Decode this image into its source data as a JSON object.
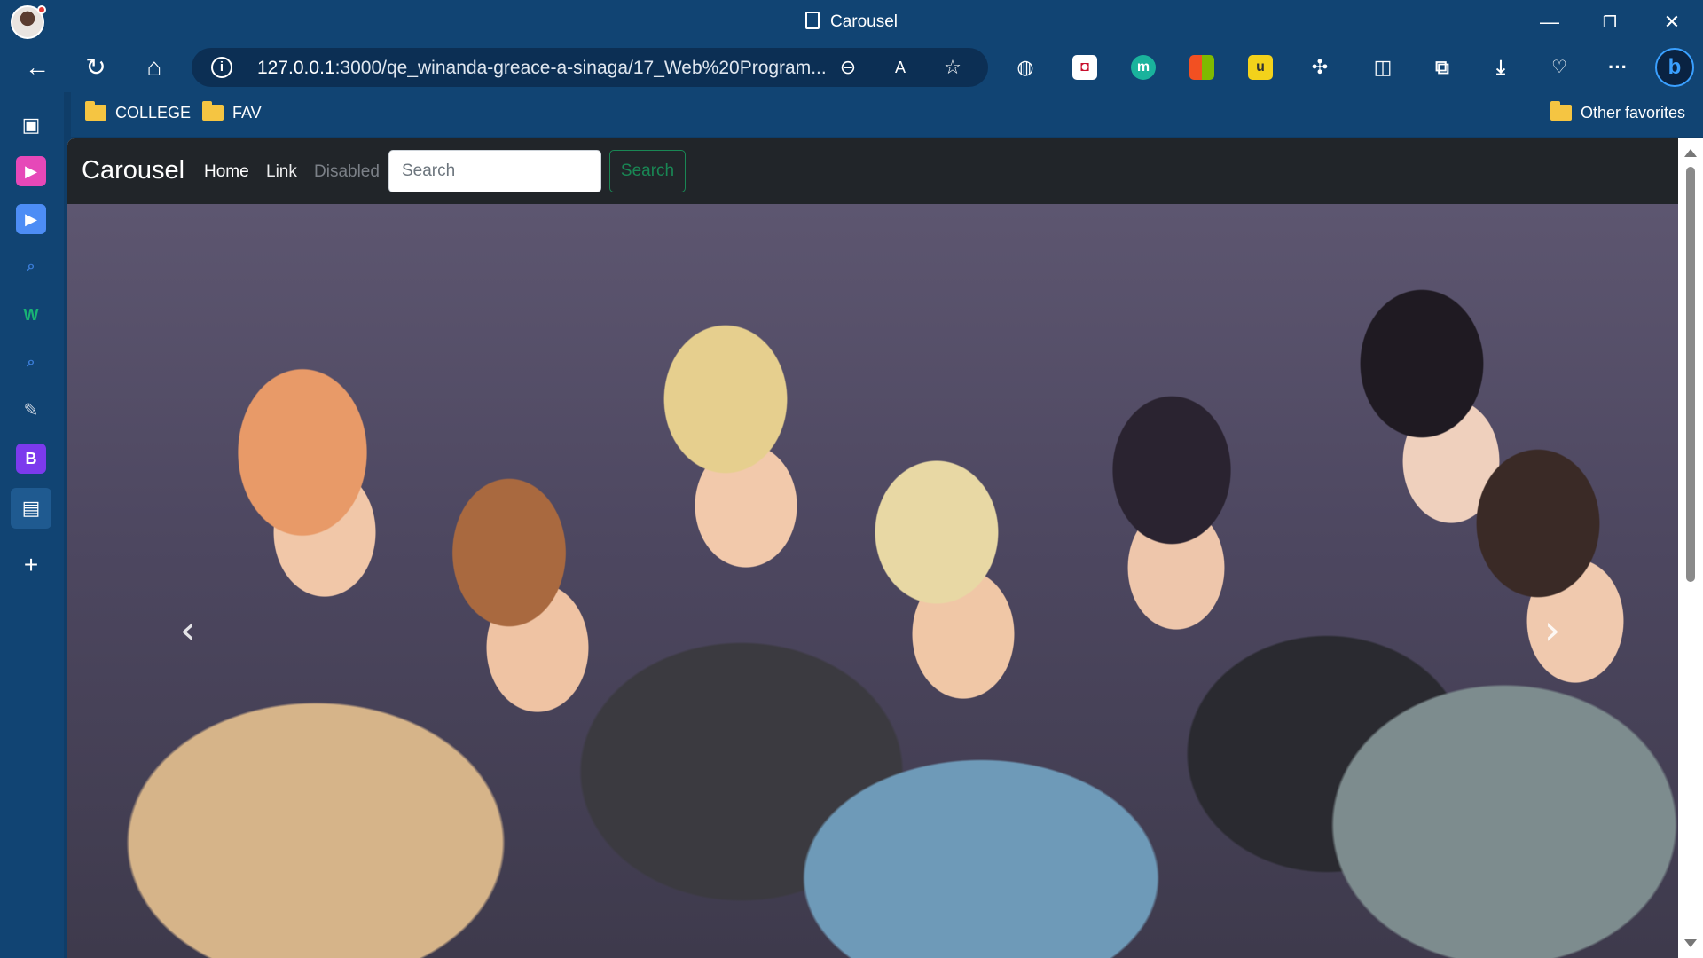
{
  "window": {
    "tab_title": "Carousel",
    "controls": {
      "minimize": "—",
      "restore": "❐",
      "close": "✕"
    }
  },
  "toolbar": {
    "url_host": "127.0.0.1",
    "url_rest": ":3000/qe_winanda-greace-a-sinaga/17_Web%20Program...",
    "more_label": "···",
    "extensions": [
      "globe-icon",
      "mcafee-icon",
      "m-icon",
      "microsoft-icon",
      "ml-icon",
      "extensions-icon"
    ]
  },
  "bookmarks": {
    "items": [
      {
        "label": "COLLEGE"
      },
      {
        "label": "FAV"
      }
    ],
    "other": "Other favorites"
  },
  "sidebar": {
    "items": [
      "tabs-icon",
      "play-icon",
      "video-icon",
      "search-icon",
      "w-icon",
      "search-icon-2",
      "wand-icon",
      "b-icon",
      "page-icon",
      "add-icon"
    ]
  },
  "page": {
    "brand": "Carousel",
    "nav": [
      {
        "label": "Home"
      },
      {
        "label": "Link"
      },
      {
        "label": "Disabled"
      }
    ],
    "search": {
      "placeholder": "Search",
      "button": "Search"
    },
    "carousel": {
      "prev": "‹",
      "next": "›"
    }
  }
}
